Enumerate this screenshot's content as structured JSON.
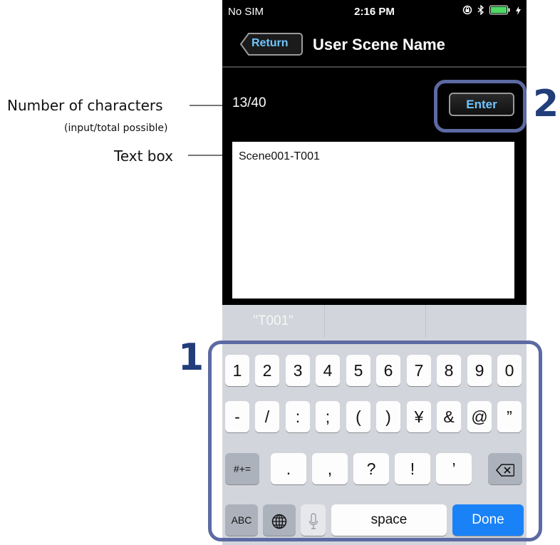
{
  "status_bar": {
    "carrier": "No SIM",
    "time": "2:16 PM"
  },
  "nav": {
    "back_label": "Return",
    "title": "User Scene Name"
  },
  "form": {
    "count": "13/40",
    "enter_label": "Enter",
    "text_value": "Scene001-T001"
  },
  "annotations": {
    "count_label": "Number of characters",
    "count_sub": "(input/total possible)",
    "textbox_label": "Text box",
    "callout_keyboard": "1",
    "callout_enter": "2"
  },
  "suggestions": [
    "\"T001\"",
    "",
    ""
  ],
  "keyboard": {
    "row1": [
      "1",
      "2",
      "3",
      "4",
      "5",
      "6",
      "7",
      "8",
      "9",
      "0"
    ],
    "row2": [
      "-",
      "/",
      ":",
      ";",
      "(",
      ")",
      "¥",
      "&",
      "@",
      "”"
    ],
    "row3": [
      ".",
      ",",
      "?",
      "!",
      "’"
    ],
    "symbols_label": "#+=",
    "abc_label": "ABC",
    "space_label": "space",
    "done_label": "Done"
  },
  "colors": {
    "callout": "#213d7a",
    "outline": "#5c6aa3",
    "done": "#1a82f7",
    "enter_text": "#6fc6ff"
  },
  "icons": [
    "lock-rotation-icon",
    "bluetooth-icon",
    "battery-icon",
    "charging-bolt-icon",
    "globe-icon",
    "microphone-icon",
    "backspace-icon"
  ]
}
